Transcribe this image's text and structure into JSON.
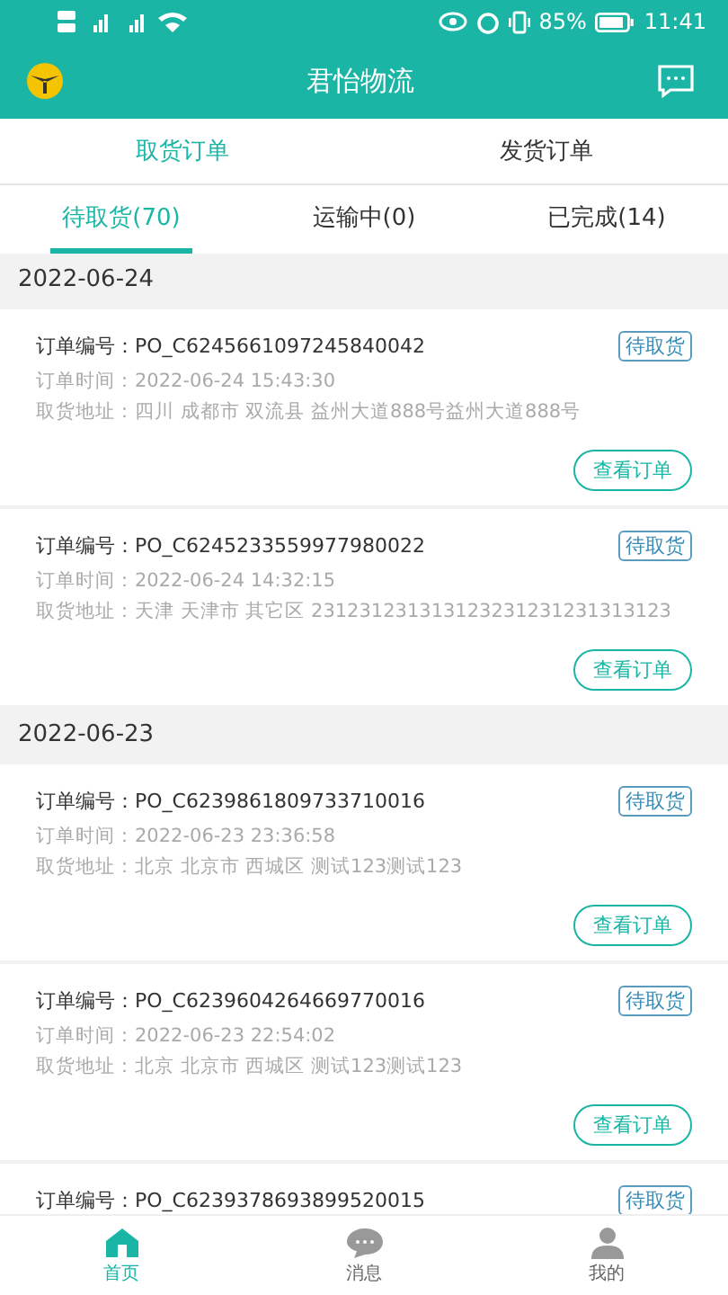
{
  "status_bar": {
    "battery": "85%",
    "time": "11:41"
  },
  "header": {
    "title": "君怡物流"
  },
  "order_type_tabs": [
    {
      "label": "取货订单",
      "selected": true
    },
    {
      "label": "发货订单",
      "selected": false
    }
  ],
  "status_tabs": [
    {
      "label": "待取货(70)",
      "selected": true
    },
    {
      "label": "运输中(0)",
      "selected": false
    },
    {
      "label": "已完成(14)",
      "selected": false
    }
  ],
  "groups": [
    {
      "date": "2022-06-24",
      "orders": [
        {
          "number_label": "订单编号：",
          "number": "PO_C6245661097245840042",
          "status": "待取货",
          "time_label": "订单时间：",
          "time": "2022-06-24 15:43:30",
          "address_label": "取货地址：",
          "address": "四川 成都市 双流县 益州大道888号益州大道888号",
          "button": "查看订单"
        },
        {
          "number_label": "订单编号：",
          "number": "PO_C6245233559977980022",
          "status": "待取货",
          "time_label": "订单时间：",
          "time": "2022-06-24 14:32:15",
          "address_label": "取货地址：",
          "address": "天津 天津市 其它区 231231231313123231231231313123",
          "button": "查看订单"
        }
      ]
    },
    {
      "date": "2022-06-23",
      "orders": [
        {
          "number_label": "订单编号：",
          "number": "PO_C6239861809733710016",
          "status": "待取货",
          "time_label": "订单时间：",
          "time": "2022-06-23 23:36:58",
          "address_label": "取货地址：",
          "address": "北京 北京市 西城区 测试123测试123",
          "button": "查看订单"
        },
        {
          "number_label": "订单编号：",
          "number": "PO_C6239604264669770016",
          "status": "待取货",
          "time_label": "订单时间：",
          "time": "2022-06-23 22:54:02",
          "address_label": "取货地址：",
          "address": "北京 北京市 西城区 测试123测试123",
          "button": "查看订单"
        },
        {
          "number_label": "订单编号：",
          "number": "PO_C6239378693899520015",
          "status": "待取货"
        }
      ]
    }
  ],
  "bottom_nav": [
    {
      "label": "首页",
      "kind": "home",
      "selected": true
    },
    {
      "label": "消息",
      "kind": "message",
      "selected": false
    },
    {
      "label": "我的",
      "kind": "profile",
      "selected": false
    }
  ]
}
